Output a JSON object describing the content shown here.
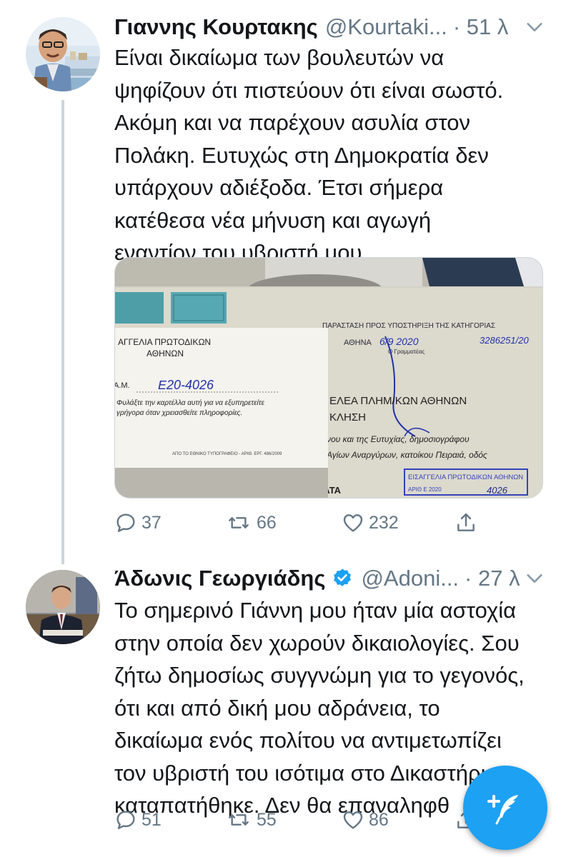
{
  "tweets": [
    {
      "name": "Γιαννης Κουρτακης",
      "handle": "@Kourtaki...",
      "time": "· 51 λ",
      "text": "Είναι δικαίωμα των βουλευτών να\nψηφίζουν ότι πιστεύουν ότι είναι σωστό.\nΑκόμη και να παρέχουν ασυλία στον\nΠολάκη. Ευτυχώς στη Δημοκρατία δεν\nυπάρχουν αδιέξοδα. Έτσι σήμερα\nκατέθεσα νέα μήνυση και αγωγή\nεναντίον του υβριστή μου",
      "media_text": {
        "card_title": "ΑΓΓΕΛΙΑ ΠΡΩΤΟΔΙΚΩΝ\nΑΘΗΝΩΝ",
        "card_am": "Α.Μ.",
        "card_number": "Ε20-4026",
        "card_note": "Φυλάξτε την καρτέλλα αυτή για να εξυπηρετείτε\nγρήγορα όταν χρειασθείτε πληροφορίες.",
        "card_footer": "ΑΠΟ ΤΟ ΕΘΝΙΚΟ ΤΥΠΟΓΡΑΦΕΙΟ - ΑΡΙΘ. ΕΡΓ. 486/2009",
        "stamp_top": "ΠΑΡΑΣΤΑΣΗ ΠΡΟΣ ΥΠΟΣΤΗΡΙΞΗ ΤΗΣ ΚΑΤΗΓΟΡΙΑΣ",
        "stamp_city": "ΑΘΗΝΑ",
        "stamp_date": "6/9 2020",
        "stamp_number": "3286251/20",
        "stamp_sub": "Ο Γραμματέας",
        "doc_line1": "ΕΛΕΑ ΠΛΗΜ/ΚΩΝ ΑΘΗΝΩΝ",
        "doc_line2": "ΚΛΗΣΗ",
        "doc_line3": "νου και της Ευτυχίας, δημοσιογράφου",
        "doc_line4": "Αγίων Αναργύρων, κατοίκου Πειραιά, οδός",
        "doc_kata": "ΚΑΤΑ",
        "blue_stamp": "ΕΙΣΑΓΓΕΛΙΑ ΠΡΩΤΟΔΙΚΩΝ ΑΘΗΝΩΝ",
        "blue_stamp_sub": "ΑΡΙΘ Ε 2020",
        "blue_stamp_num": "4026"
      },
      "replies": "37",
      "retweets": "66",
      "likes": "232"
    },
    {
      "name": "Άδωνις Γεωργιάδης",
      "handle": "@Adoni...",
      "time": "· 27 λ",
      "text": "Το σημερινό Γιάννη μου ήταν μία αστοχία\nστην οποία δεν χωρούν δικαιολογίες. Σου\nζήτω δημοσίως συγγνώμη για το γεγονός,\nότι και από δική μου αδράνεια, το\nδικαίωμα ενός πολίτου να αντιμετωπίζει\nτον υβριστή του ισότιμα στο Δικαστήριο\nκαταπατήθηκε. Δεν θα επαναληφθ",
      "replies": "51",
      "retweets": "55",
      "likes": "86"
    }
  ],
  "icons": {
    "reply": "reply-icon",
    "retweet": "retweet-icon",
    "like": "heart-icon",
    "share": "share-icon",
    "caret": "chevron-down-icon",
    "verified": "verified-badge-icon",
    "compose": "compose-tweet-icon"
  },
  "colors": {
    "accent": "#1da1f2",
    "text": "#14171a",
    "muted": "#657786",
    "thread_line": "#ccd6dd"
  }
}
